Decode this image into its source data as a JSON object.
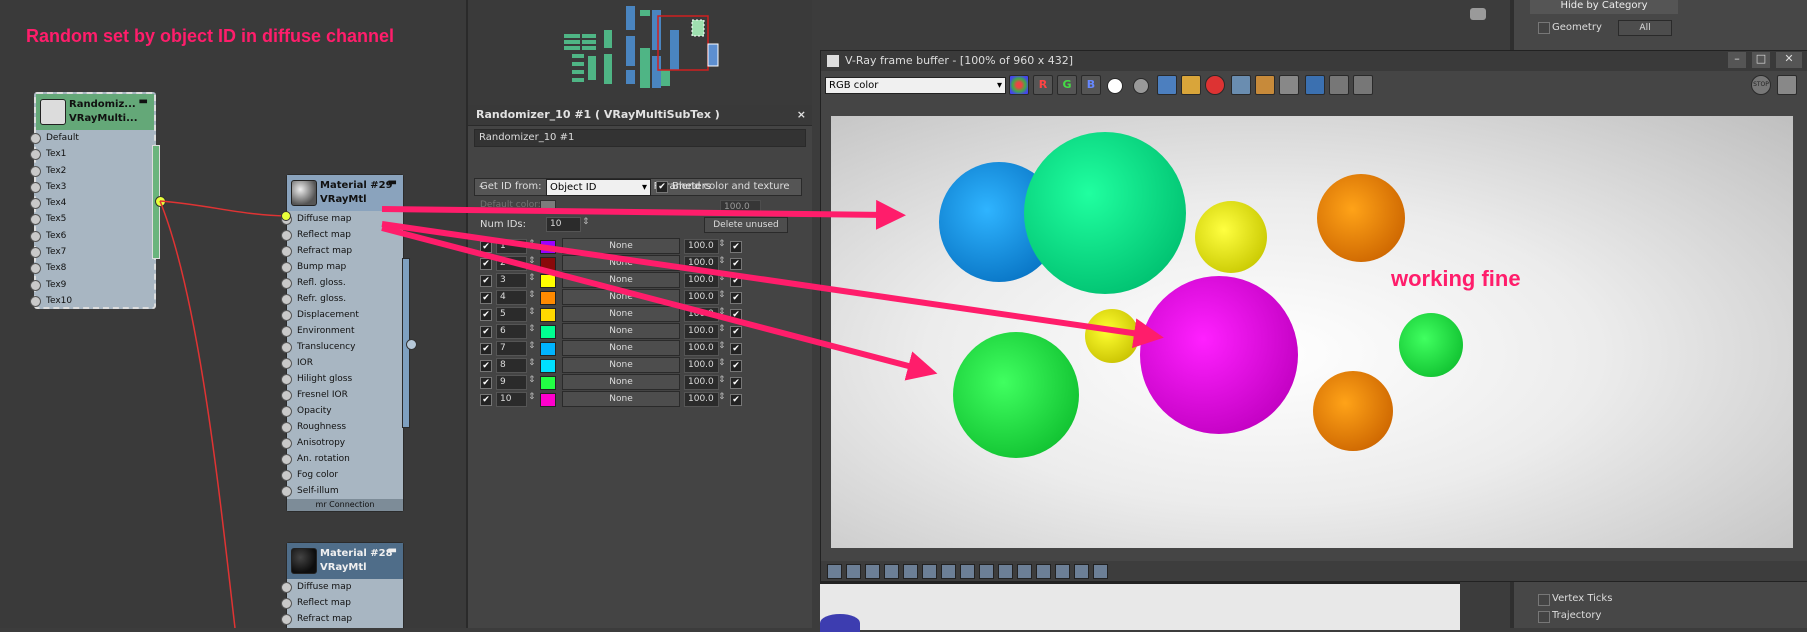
{
  "annotations": {
    "top_caption": "Random set by object ID in diffuse channel",
    "render_caption": "working fine",
    "caption_color": "#ff1d6b"
  },
  "nodes": {
    "randomizer": {
      "title_line1": "Randomiz...",
      "title_line2": "VRayMulti...",
      "slots": [
        "Default",
        "Tex1",
        "Tex2",
        "Tex3",
        "Tex4",
        "Tex5",
        "Tex6",
        "Tex7",
        "Tex8",
        "Tex9",
        "Tex10"
      ]
    },
    "material29": {
      "title_line1": "Material #29",
      "title_line2": "VRayMtl",
      "slots": [
        "Diffuse map",
        "Reflect map",
        "Refract map",
        "Bump map",
        "Refl. gloss.",
        "Refr. gloss.",
        "Displacement",
        "Environment",
        "Translucency",
        "IOR",
        "Hilight gloss",
        "Fresnel IOR",
        "Opacity",
        "Roughness",
        "Anisotropy",
        "An. rotation",
        "Fog color",
        "Self-illum"
      ],
      "footer": "mr Connection"
    },
    "material28": {
      "title_line1": "Material #28",
      "title_line2": "VRayMtl",
      "slots": [
        "Diffuse map",
        "Reflect map",
        "Refract map"
      ]
    }
  },
  "param_panel": {
    "title": "Randomizer_10 #1  ( VRayMultiSubTex )",
    "name_value": "Randomizer_10 #1",
    "rollout_title": "VRayMultiSubTex Parameters",
    "get_id_label": "Get ID from:",
    "get_id_value": "Object ID",
    "blend_label": "Blend color and texture",
    "default_color_label": "Default color:",
    "default_amount": "100.0",
    "num_ids_label": "Num IDs:",
    "num_ids_value": "10",
    "delete_unused_label": "Delete unused",
    "rows": [
      {
        "id": "1",
        "color": "#9a00ff",
        "map": "None",
        "amount": "100.0"
      },
      {
        "id": "2",
        "color": "#8a0a0a",
        "map": "None",
        "amount": "100.0"
      },
      {
        "id": "3",
        "color": "#ffff00",
        "map": "None",
        "amount": "100.0"
      },
      {
        "id": "4",
        "color": "#ff8a00",
        "map": "None",
        "amount": "100.0"
      },
      {
        "id": "5",
        "color": "#ffd800",
        "map": "None",
        "amount": "100.0"
      },
      {
        "id": "6",
        "color": "#00ff90",
        "map": "None",
        "amount": "100.0"
      },
      {
        "id": "7",
        "color": "#00b4ff",
        "map": "None",
        "amount": "100.0"
      },
      {
        "id": "8",
        "color": "#00e0ff",
        "map": "None",
        "amount": "100.0"
      },
      {
        "id": "9",
        "color": "#22ff44",
        "map": "None",
        "amount": "100.0"
      },
      {
        "id": "10",
        "color": "#ff00cc",
        "map": "None",
        "amount": "100.0"
      }
    ]
  },
  "vfb": {
    "title": "V-Ray frame buffer - [100% of 960 x 432]",
    "channel": "RGB color",
    "btn_r": "R",
    "btn_g": "G",
    "btn_b": "B",
    "btn_stop": "STOP"
  },
  "right_panel": {
    "section_title": "Hide by Category",
    "geometry_label": "Geometry",
    "all_button": "All",
    "vertex_ticks": "Vertex Ticks",
    "trajectory": "Trajectory"
  }
}
